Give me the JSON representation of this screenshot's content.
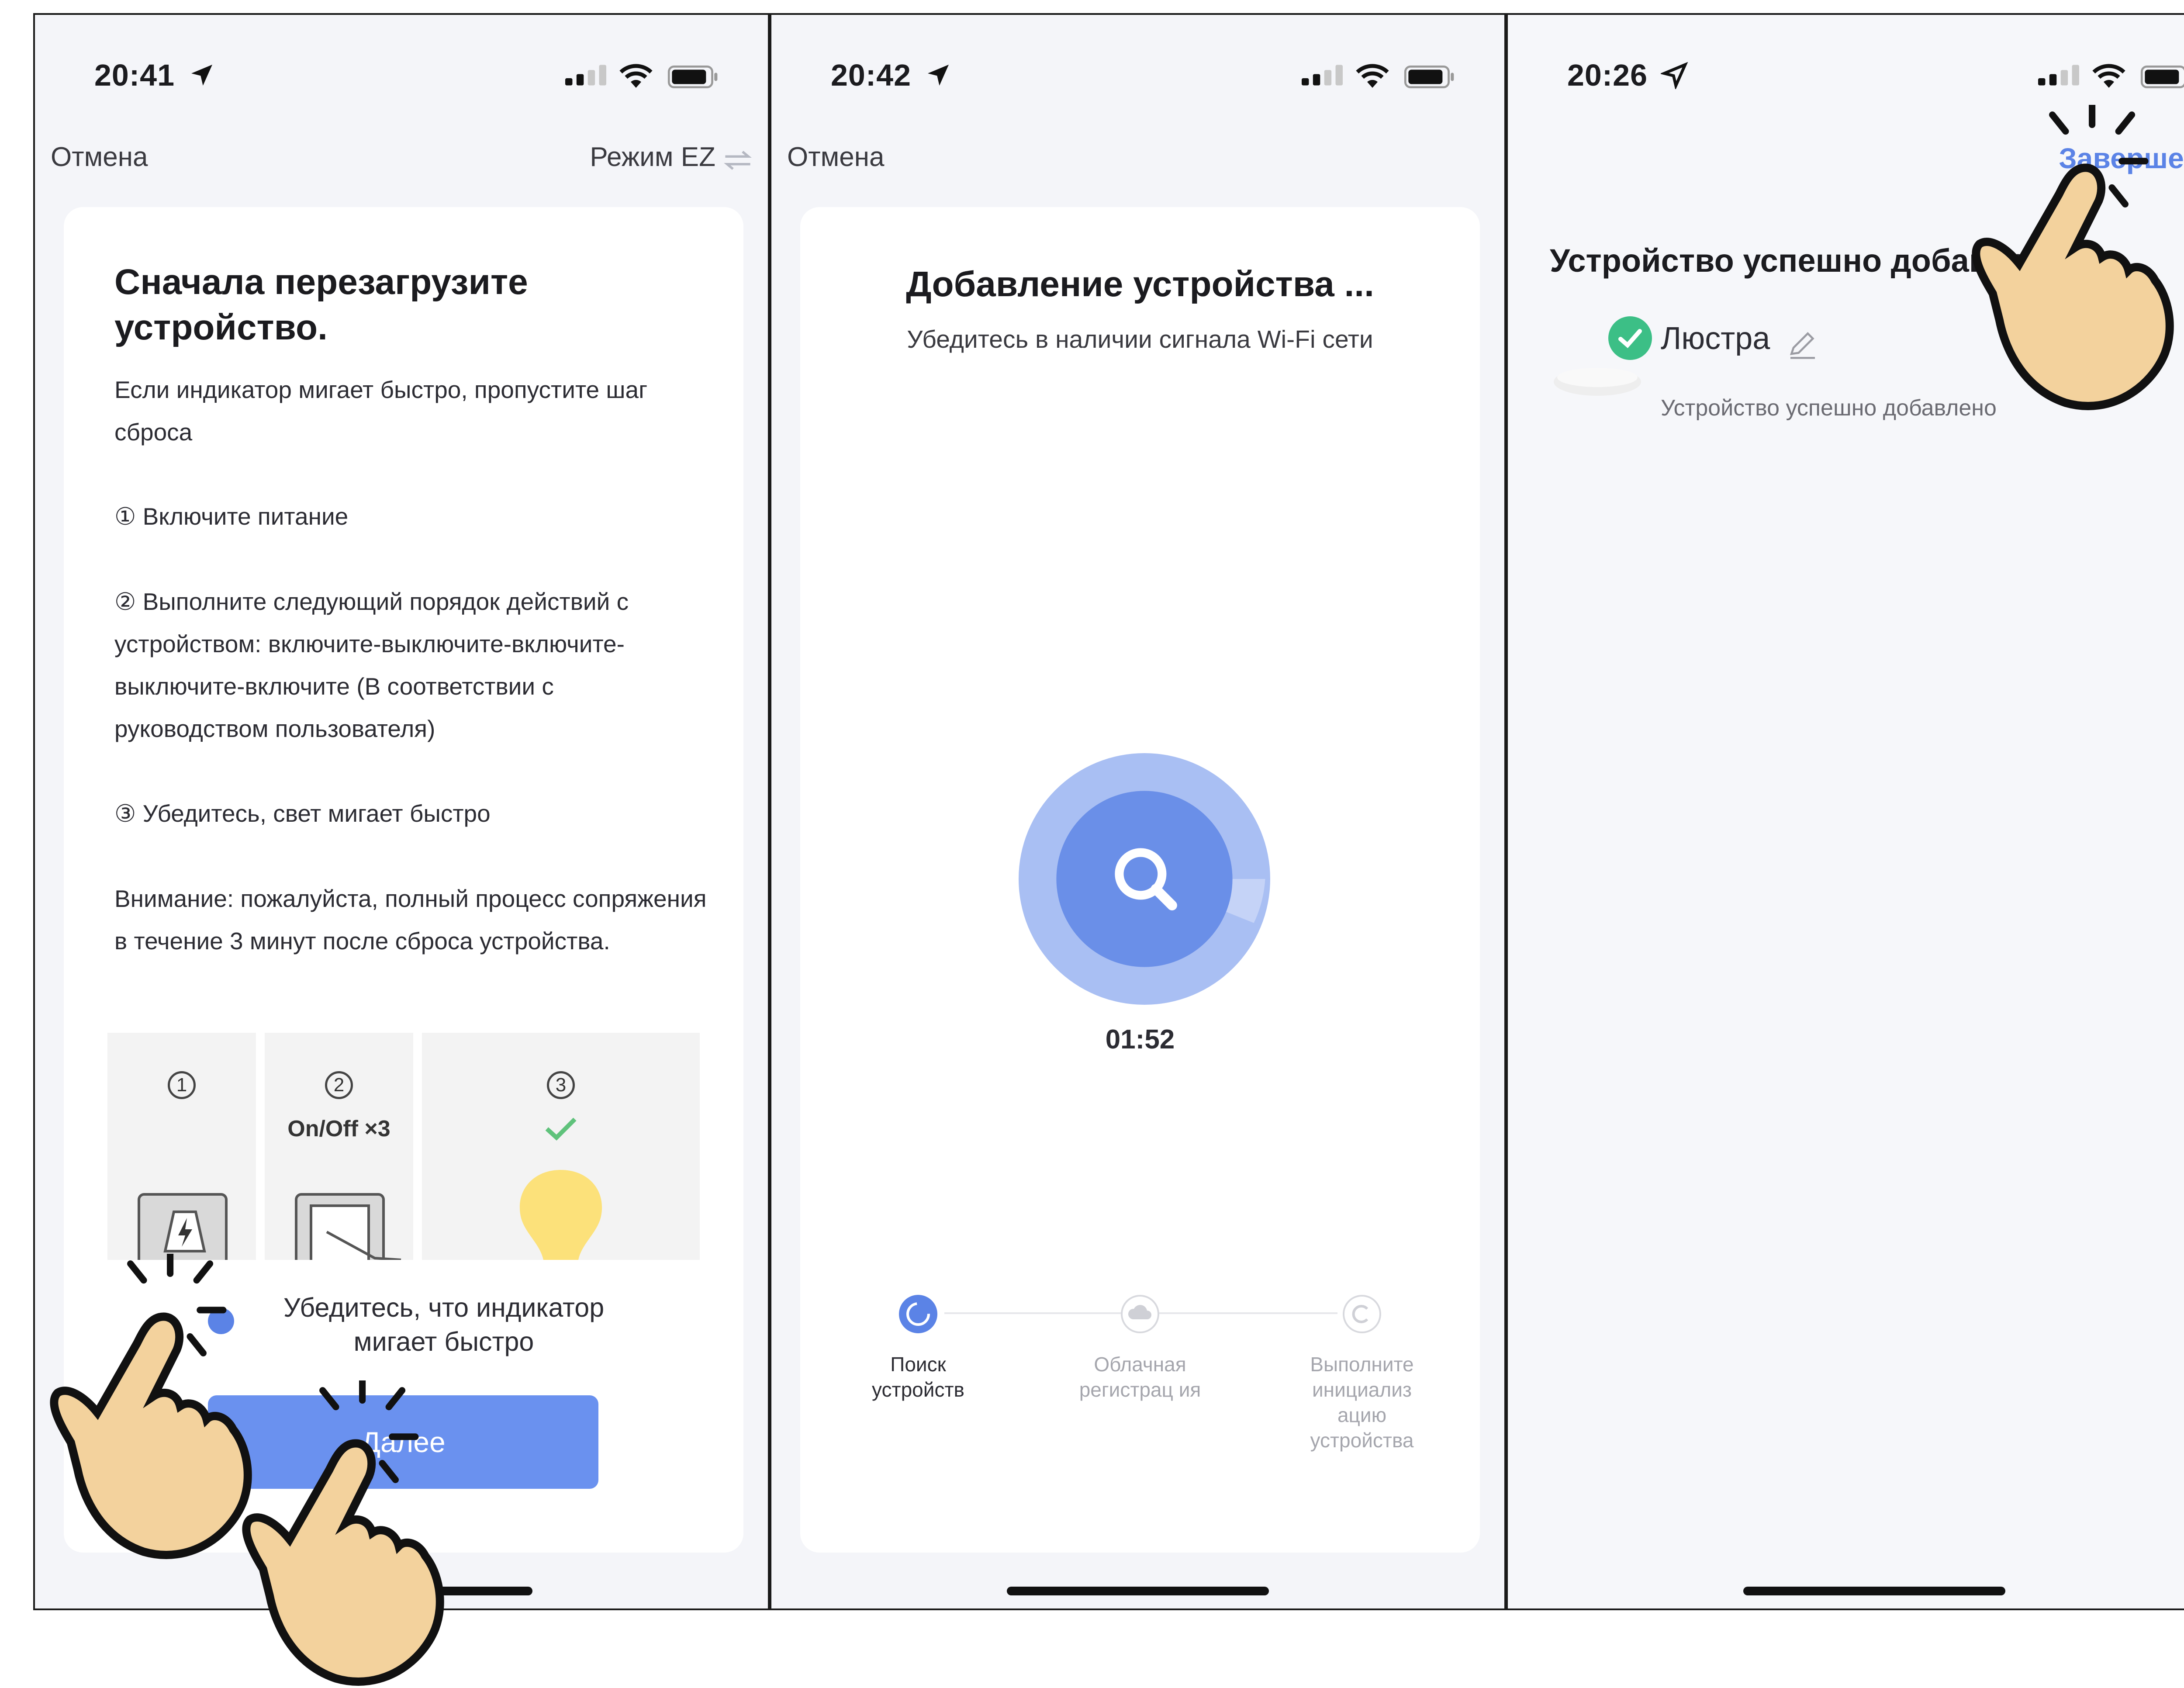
{
  "colors": {
    "accent": "#5b83e6",
    "button": "#6a91ef",
    "success": "#3cbf86",
    "hand_fill": "#f3d29d"
  },
  "screen1": {
    "time": "20:41",
    "nav": {
      "cancel": "Отмена",
      "mode": "Режим EZ"
    },
    "title": "Сначала перезагрузите устройство.",
    "intro": "Если индикатор мигает быстро, пропустите шаг сброса",
    "step1": "① Включите питание",
    "step2": "② Выполните следующий порядок действий с устройством: включите-выключите-включите-выключите-включите (В соответствии с руководством пользователя)",
    "step3": "③ Убедитесь, свет мигает быстро",
    "note": "Внимание: пожалуйста, полный процесс сопряжения в течение 3 минут после сброса устройства.",
    "illus": [
      {
        "num": "1"
      },
      {
        "num": "2",
        "caption": "On/Off ×3"
      },
      {
        "num": "3"
      }
    ],
    "confirm_text": "Убедитесь, что индикатор мигает быстро",
    "next_button": "Далее"
  },
  "screen2": {
    "time": "20:42",
    "nav": {
      "cancel": "Отмена"
    },
    "title": "Добавление устройства ...",
    "subtitle": "Убедитесь в наличии сигнала Wi-Fi сети",
    "timer": "01:52",
    "steps": [
      {
        "label": "Поиск устройств",
        "state": "active"
      },
      {
        "label": "Облачная регистрац ия",
        "state": "pending"
      },
      {
        "label": "Выполните инициализ ацию устройства",
        "state": "pending"
      }
    ]
  },
  "screen3": {
    "time": "20:26",
    "nav": {
      "done": "Завершено"
    },
    "title": "Устройство успешно добавлено",
    "device_name": "Люстра",
    "device_status": "Устройство успешно добавлено"
  }
}
